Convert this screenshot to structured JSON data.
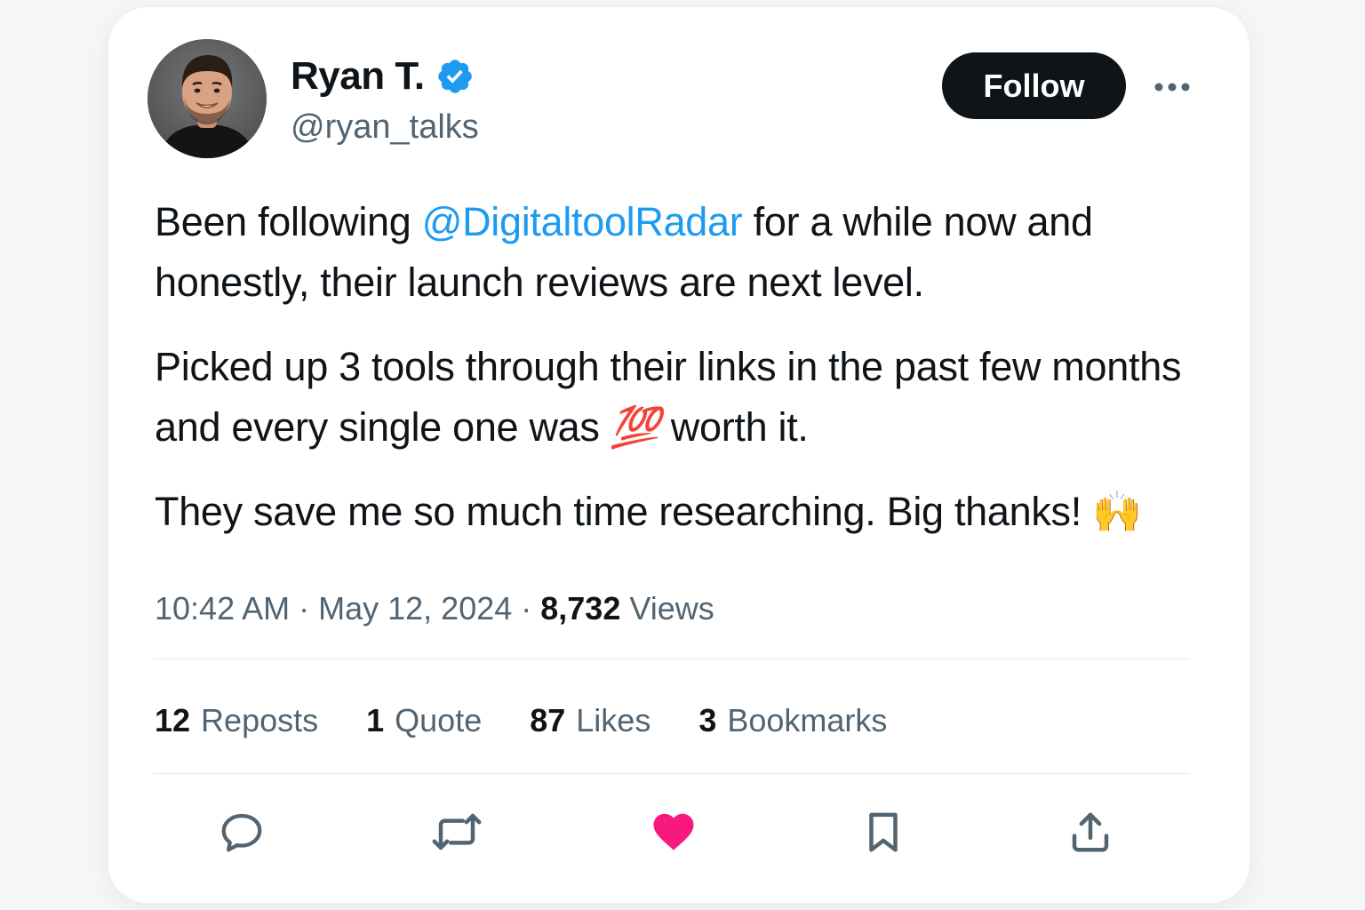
{
  "author": {
    "name": "Ryan T.",
    "handle": "@ryan_talks",
    "verified": true,
    "avatar_icon": "user-avatar-photo"
  },
  "follow_label": "Follow",
  "more_icon": "more-horizontal-icon",
  "tweet": {
    "p1_before": "Been following ",
    "p1_mention": "@DigitaltoolRadar",
    "p1_after": " for a while now and honestly, their launch reviews are next level.",
    "p2_before": "Picked up 3 tools through their links in the past few months and every single one was ",
    "p2_emoji": "💯",
    "p2_after": " worth it.",
    "p3_text": "They save me so much time researching. Big thanks! ",
    "p3_emoji": "🙌"
  },
  "meta": {
    "time": "10:42 AM",
    "separator": "·",
    "date": "May 12, 2024",
    "views_count": "8,732",
    "views_label": "Views"
  },
  "stats": {
    "reposts": {
      "count": "12",
      "label": "Reposts"
    },
    "quotes": {
      "count": "1",
      "label": "Quote"
    },
    "likes": {
      "count": "87",
      "label": "Likes"
    },
    "bookmarks": {
      "count": "3",
      "label": "Bookmarks"
    }
  },
  "actions": {
    "reply_icon": "reply-icon",
    "repost_icon": "repost-icon",
    "like_icon": "heart-icon",
    "like_active": true,
    "bookmark_icon": "bookmark-icon",
    "share_icon": "share-icon"
  },
  "colors": {
    "accent_blue": "#1d9bf0",
    "like_pink": "#f91880",
    "text_primary": "#0f1419",
    "text_secondary": "#536471",
    "button_dark": "#0f1419"
  }
}
